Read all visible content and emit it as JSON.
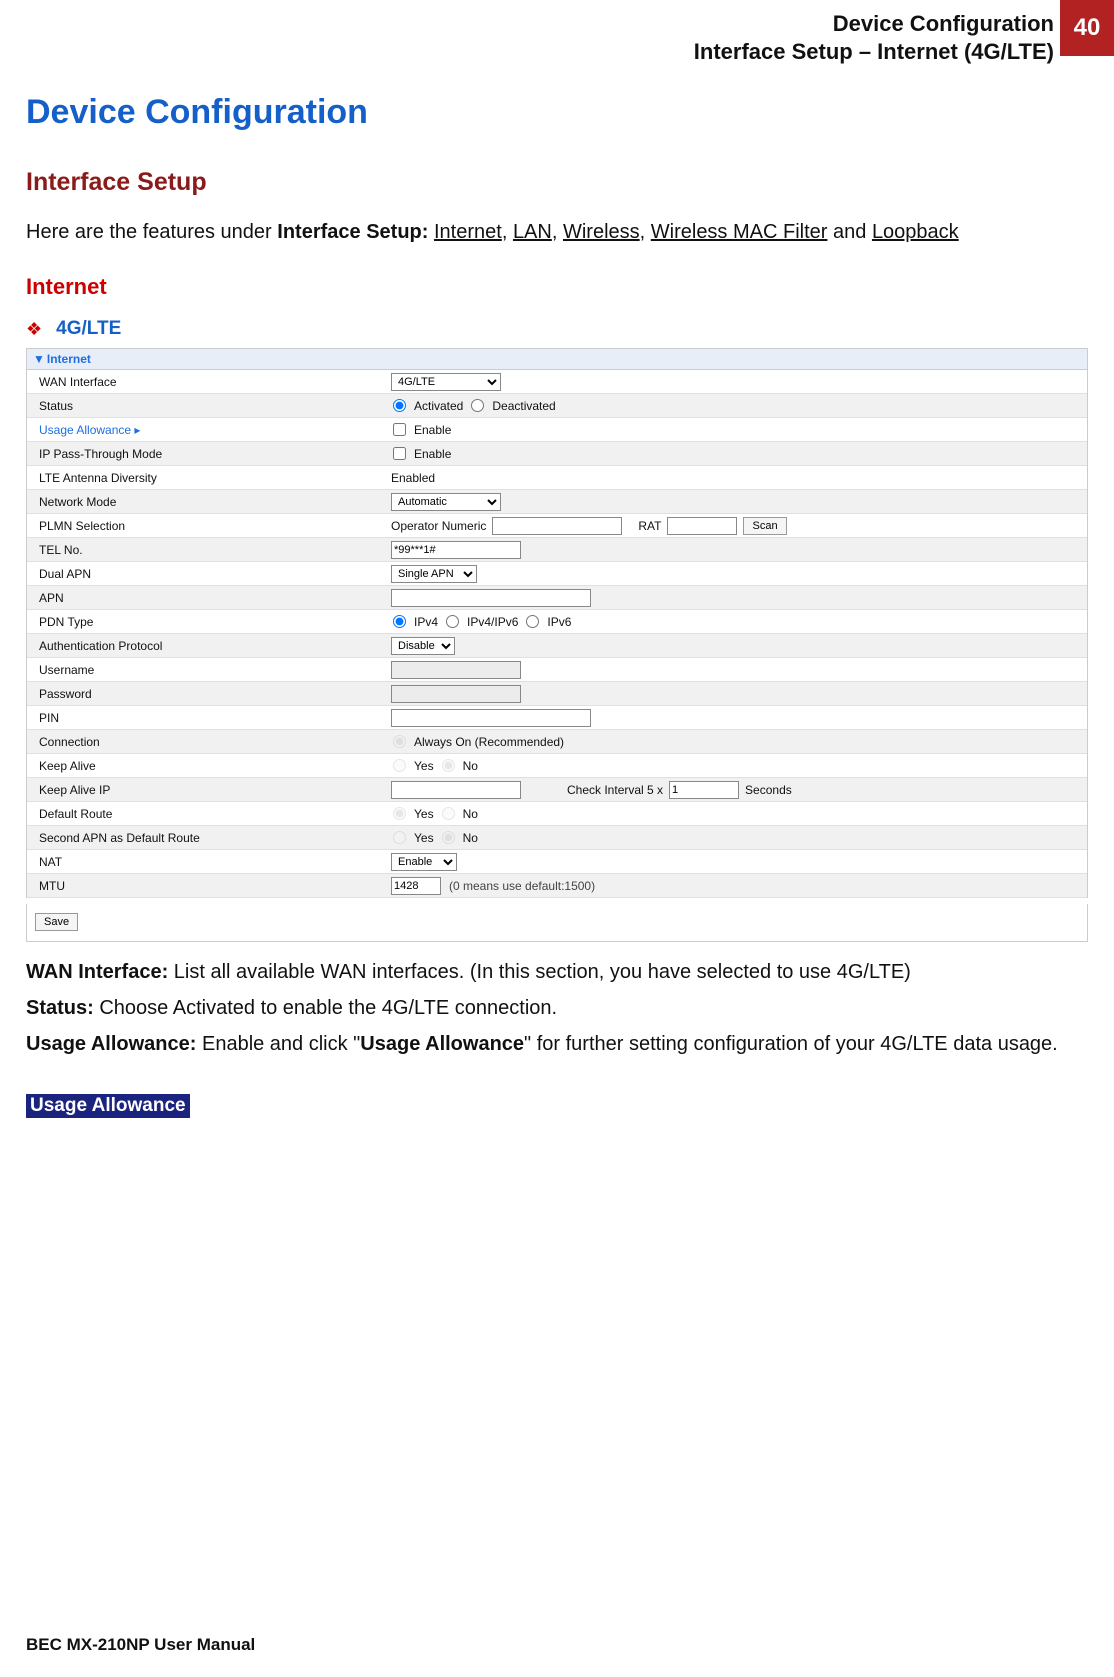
{
  "header": {
    "line1": "Device Configuration",
    "line2": "Interface Setup – Internet (4G/LTE)",
    "page_number": "40"
  },
  "title": "Device Configuration",
  "section": "Interface Setup",
  "intro": {
    "prefix": "Here are the features under ",
    "bold": "Interface Setup:",
    "items": [
      "Internet",
      "LAN",
      "Wireless",
      "Wireless MAC Filter"
    ],
    "and": " and ",
    "last": "Loopback"
  },
  "internet_heading": "Internet",
  "subheading": "4G/LTE",
  "panel_title": "Internet",
  "rows": {
    "wan_interface": {
      "label": "WAN Interface",
      "value": "4G/LTE"
    },
    "status": {
      "label": "Status",
      "opt1": "Activated",
      "opt2": "Deactivated"
    },
    "usage_allowance": {
      "label": "Usage Allowance ▸",
      "value": "Enable"
    },
    "ip_passthrough": {
      "label": "IP Pass-Through Mode",
      "value": "Enable"
    },
    "lte_antenna": {
      "label": "LTE Antenna Diversity",
      "value": "Enabled"
    },
    "network_mode": {
      "label": "Network Mode",
      "value": "Automatic"
    },
    "plmn": {
      "label": "PLMN Selection",
      "text1": "Operator Numeric",
      "text2": "RAT",
      "btn": "Scan"
    },
    "tel_no": {
      "label": "TEL No.",
      "value": "*99***1#"
    },
    "dual_apn": {
      "label": "Dual APN",
      "value": "Single APN"
    },
    "apn": {
      "label": "APN"
    },
    "pdn_type": {
      "label": "PDN Type",
      "opt1": "IPv4",
      "opt2": "IPv4/IPv6",
      "opt3": "IPv6"
    },
    "auth": {
      "label": "Authentication Protocol",
      "value": "Disable"
    },
    "username": {
      "label": "Username"
    },
    "password": {
      "label": "Password"
    },
    "pin": {
      "label": "PIN"
    },
    "connection": {
      "label": "Connection",
      "opt1": "Always On (Recommended)"
    },
    "keep_alive": {
      "label": "Keep Alive",
      "opt1": "Yes",
      "opt2": "No"
    },
    "keep_alive_ip": {
      "label": "Keep Alive IP",
      "text1": "Check Interval 5 x",
      "value": "1",
      "text2": "Seconds"
    },
    "default_route": {
      "label": "Default Route",
      "opt1": "Yes",
      "opt2": "No"
    },
    "second_apn_default": {
      "label": "Second APN as Default Route",
      "opt1": "Yes",
      "opt2": "No"
    },
    "nat": {
      "label": "NAT",
      "value": "Enable"
    },
    "mtu": {
      "label": "MTU",
      "value": "1428",
      "note": "(0 means use default:1500)"
    }
  },
  "save_label": "Save",
  "descriptions": {
    "d1_label": "WAN Interface:",
    "d1_text": " List all available WAN interfaces. (In this section, you have selected to use 4G/LTE)",
    "d2_label": "Status:",
    "d2_text": " Choose Activated to enable the 4G/LTE connection.",
    "d3_label": "Usage Allowance:",
    "d3_text_a": "  Enable and click \"",
    "d3_bold": "Usage Allowance",
    "d3_text_b": "\" for further setting configuration of your 4G/LTE data usage."
  },
  "highlight": "Usage Allowance",
  "footer": "BEC MX-210NP User Manual"
}
